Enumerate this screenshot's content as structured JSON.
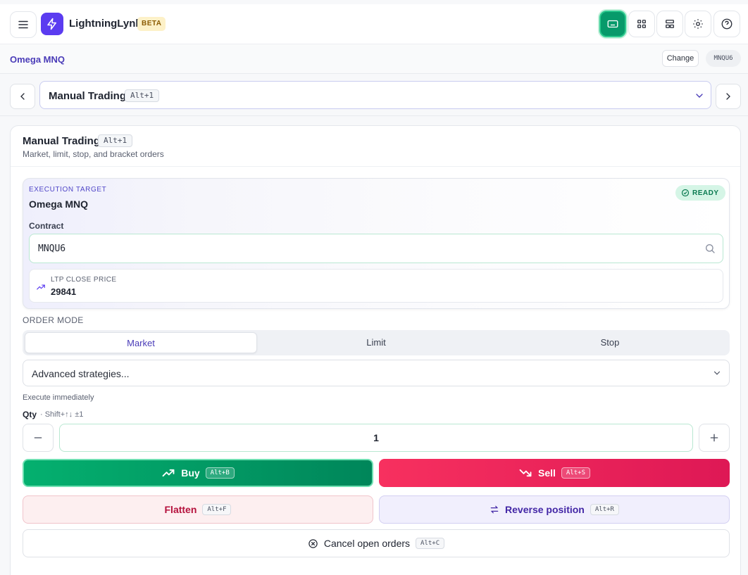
{
  "header": {
    "brand": "LightningLynk",
    "badge": "BETA",
    "icons": [
      "menu-icon",
      "lightning-icon",
      "keyboard-icon",
      "grid-icon",
      "layout-icon",
      "gear-icon",
      "help-icon"
    ]
  },
  "account": {
    "name": "Omega MNQ",
    "change_label": "Change",
    "contract_pill": "MNQU6"
  },
  "strategy_selector": {
    "title": "Manual Trading",
    "shortcut": "Alt+1"
  },
  "card": {
    "title": "Manual Trading",
    "shortcut": "Alt+1",
    "subtitle": "Market, limit, stop, and bracket orders"
  },
  "execution": {
    "label": "EXECUTION TARGET",
    "target": "Omega MNQ",
    "status": "READY",
    "contract_label": "Contract",
    "contract_value": "MNQU6",
    "ltp_label": "LTP CLOSE PRICE",
    "ltp_value": "29841"
  },
  "order_mode": {
    "label": "ORDER MODE",
    "tabs": [
      "Market",
      "Limit",
      "Stop"
    ],
    "selected": "Market",
    "advanced_placeholder": "Advanced strategies...",
    "hint": "Execute immediately"
  },
  "qty": {
    "label": "Qty",
    "hint": "· Shift+↑↓ ±1",
    "value": "1"
  },
  "actions": {
    "buy": {
      "label": "Buy",
      "shortcut": "Alt+B"
    },
    "sell": {
      "label": "Sell",
      "shortcut": "Alt+S"
    },
    "flatten": {
      "label": "Flatten",
      "shortcut": "Alt+F"
    },
    "reverse": {
      "label": "Reverse position",
      "shortcut": "Alt+R"
    },
    "cancel": {
      "label": "Cancel open orders",
      "shortcut": "Alt+C"
    }
  },
  "colors": {
    "brand": "#5b3cf0",
    "buy": "#00865a",
    "sell": "#de1855",
    "accent": "#4a3cb8"
  }
}
